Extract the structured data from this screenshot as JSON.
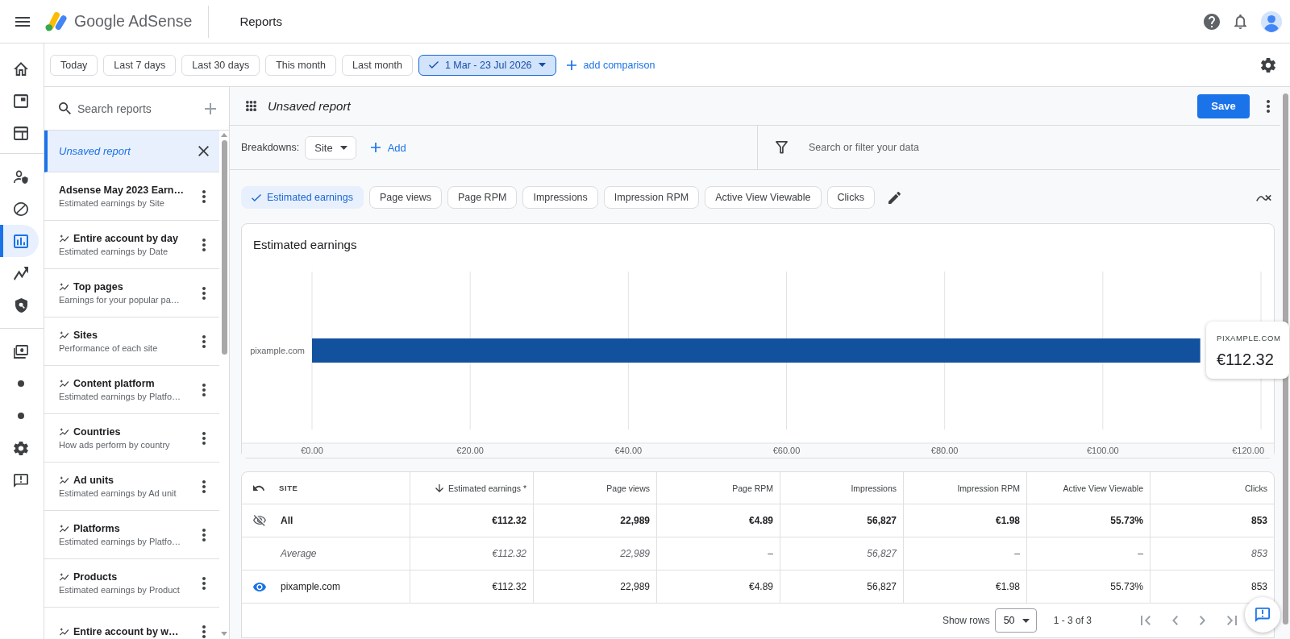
{
  "top_bar": {
    "product_name": "Google AdSense",
    "page_title": "Reports"
  },
  "nav_rail": [
    [
      {
        "kind": "home",
        "selected": false
      },
      {
        "kind": "ad",
        "selected": false
      },
      {
        "kind": "layout",
        "selected": false
      }
    ],
    [
      {
        "kind": "privacy",
        "selected": false
      },
      {
        "kind": "block",
        "selected": false
      },
      {
        "kind": "reports",
        "selected": true
      },
      {
        "kind": "trending",
        "selected": false
      },
      {
        "kind": "policy",
        "selected": false
      }
    ],
    [
      {
        "kind": "payments",
        "selected": false
      },
      {
        "kind": "dot",
        "selected": false
      },
      {
        "kind": "dot",
        "selected": false
      },
      {
        "kind": "settings",
        "selected": false
      },
      {
        "kind": "feedback",
        "selected": false
      }
    ]
  ],
  "date_ranges": [
    {
      "label": "Today",
      "selected": false
    },
    {
      "label": "Last 7 days",
      "selected": false
    },
    {
      "label": "Last 30 days",
      "selected": false
    },
    {
      "label": "This month",
      "selected": false
    },
    {
      "label": "Last month",
      "selected": false
    },
    {
      "label": "1 Mar - 23 Jul 2026",
      "selected": true
    }
  ],
  "add_comparison": "add comparison",
  "reports_panel": {
    "search": {
      "placeholder": "Search reports"
    },
    "items": [
      {
        "kind": "draft",
        "title": "Unsaved report",
        "selected": true
      },
      {
        "kind": "saved",
        "title": "Adsense May 2023 Earn…",
        "subtitle": "Estimated earnings by Site",
        "selected": false
      },
      {
        "kind": "template",
        "title": "Entire account by day",
        "subtitle": "Estimated earnings by Date",
        "selected": false
      },
      {
        "kind": "template",
        "title": "Top pages",
        "subtitle": "Earnings for your popular pa…",
        "selected": false
      },
      {
        "kind": "template",
        "title": "Sites",
        "subtitle": "Performance of each site",
        "selected": false
      },
      {
        "kind": "template",
        "title": "Content platform",
        "subtitle": "Estimated earnings by Platfo…",
        "selected": false
      },
      {
        "kind": "template",
        "title": "Countries",
        "subtitle": "How ads perform by country",
        "selected": false
      },
      {
        "kind": "template",
        "title": "Ad units",
        "subtitle": "Estimated earnings by Ad unit",
        "selected": false
      },
      {
        "kind": "template",
        "title": "Platforms",
        "subtitle": "Estimated earnings by Platfo…",
        "selected": false
      },
      {
        "kind": "template",
        "title": "Products",
        "subtitle": "Estimated earnings by Product",
        "selected": false
      },
      {
        "kind": "template",
        "title": "Entire account by w…",
        "selected": false
      }
    ]
  },
  "report": {
    "title": "Unsaved report",
    "save_button": "Save",
    "breakdowns": {
      "label": "Breakdowns:",
      "value": "Site",
      "add": "Add"
    },
    "filter": {
      "placeholder": "Search or filter your data"
    },
    "metrics": [
      {
        "label": "Estimated earnings",
        "selected": true
      },
      {
        "label": "Page views",
        "selected": false
      },
      {
        "label": "Page RPM",
        "selected": false
      },
      {
        "label": "Impressions",
        "selected": false
      },
      {
        "label": "Impression RPM",
        "selected": false
      },
      {
        "label": "Active View Viewable",
        "selected": false
      },
      {
        "label": "Clicks",
        "selected": false
      }
    ],
    "chart": {
      "chart_data": {
        "type": "bar",
        "orientation": "horizontal",
        "title": "Estimated earnings",
        "categories": [
          "pixample.com"
        ],
        "series": [
          {
            "color": "#12519e",
            "values": [
              112.32
            ]
          }
        ],
        "xlim": [
          0,
          120
        ],
        "xticks": [
          {
            "value": 0,
            "label": "€0.00"
          },
          {
            "value": 20,
            "label": "€20.00"
          },
          {
            "value": 40,
            "label": "€40.00"
          },
          {
            "value": 60,
            "label": "€60.00"
          },
          {
            "value": 80,
            "label": "€80.00"
          },
          {
            "value": 100,
            "label": "€100.00"
          },
          {
            "value": 120,
            "label": "€120.00"
          }
        ],
        "grid": true
      },
      "tooltip": {
        "label": "PIXAMPLE.COM",
        "value": "€112.32"
      }
    },
    "table": {
      "columns": [
        {
          "label": "SITE",
          "sorted": false
        },
        {
          "label": "Estimated earnings *",
          "sorted": true
        },
        {
          "label": "Page views",
          "sorted": false
        },
        {
          "label": "Page RPM",
          "sorted": false
        },
        {
          "label": "Impressions",
          "sorted": false
        },
        {
          "label": "Impression RPM",
          "sorted": false
        },
        {
          "label": "Active View Viewable",
          "sorted": false
        },
        {
          "label": "Clicks",
          "sorted": false
        }
      ],
      "rows": [
        {
          "kind": "total",
          "visible": false,
          "cells": [
            "All",
            "€112.32",
            "22,989",
            "€4.89",
            "56,827",
            "€1.98",
            "55.73%",
            "853"
          ]
        },
        {
          "kind": "average",
          "cells": [
            "Average",
            "€112.32",
            "22,989",
            "–",
            "56,827",
            "–",
            "–",
            "853"
          ]
        },
        {
          "kind": "site",
          "visible": true,
          "cells": [
            "pixample.com",
            "€112.32",
            "22,989",
            "€4.89",
            "56,827",
            "€1.98",
            "55.73%",
            "853"
          ]
        }
      ]
    },
    "pagination": {
      "label": "Show rows",
      "rows_per_page": "50",
      "range": "1 - 3 of 3"
    }
  }
}
